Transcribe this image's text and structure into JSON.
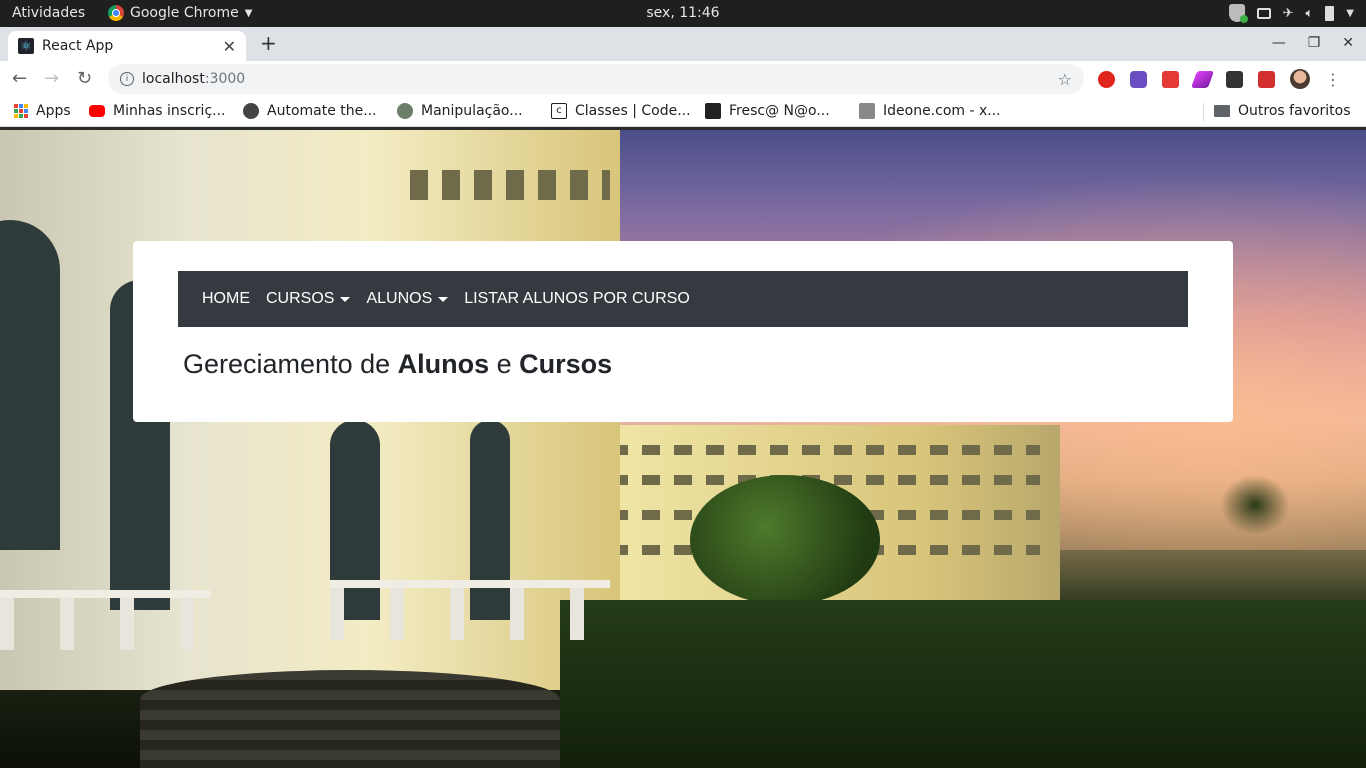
{
  "os_bar": {
    "activities": "Atividades",
    "app_name": "Google Chrome",
    "clock": "sex, 11:46"
  },
  "browser": {
    "tab_title": "React App",
    "url_host": "localhost",
    "url_port": ":3000",
    "bookmarks": [
      {
        "label": "Apps",
        "icon": "apps-grid-icon"
      },
      {
        "label": "Minhas inscriç...",
        "icon": "youtube-icon"
      },
      {
        "label": "Automate the...",
        "icon": "globe-icon"
      },
      {
        "label": "Manipulação...",
        "icon": "site-icon"
      },
      {
        "label": "Classes | Code...",
        "icon": "codecademy-icon"
      },
      {
        "label": "Fresc@ N@o...",
        "icon": "site-icon"
      },
      {
        "label": "Ideone.com - x...",
        "icon": "ideone-icon"
      }
    ],
    "other_bookmarks": "Outros favoritos"
  },
  "app": {
    "nav": {
      "home": "HOME",
      "cursos": "CURSOS",
      "alunos": "ALUNOS",
      "listar": "LISTAR ALUNOS POR CURSO"
    },
    "heading": {
      "part1": "Gereciamento de ",
      "bold1": "Alunos",
      "part2": " e ",
      "bold2": "Cursos"
    }
  },
  "colors": {
    "navbar_bg": "#343a40",
    "card_bg": "#ffffff",
    "os_bar_bg": "#1f1f1f"
  }
}
